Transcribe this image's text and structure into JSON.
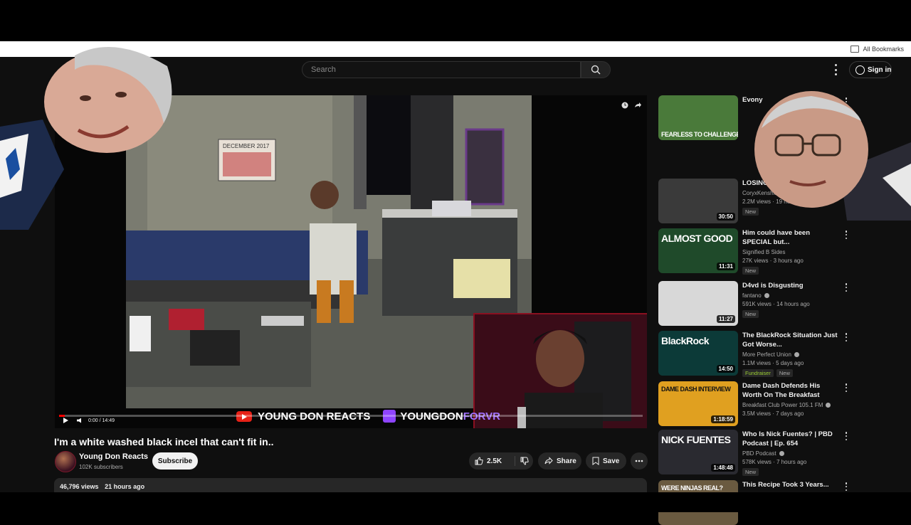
{
  "browser": {
    "bookmarks_label": "All Bookmarks"
  },
  "header": {
    "search_placeholder": "Search",
    "sign_in_label": "Sign in"
  },
  "player": {
    "time_current": "0:00",
    "time_total": "14:49",
    "progress_fraction": 0.01,
    "banner_youtube": "YOUNG DON REACTS",
    "banner_twitch_prefix": "YOUNGDON",
    "banner_twitch_suffix": "FORVR",
    "calendar_text": "DECEMBER 2017"
  },
  "video": {
    "title": "I'm a white washed black incel that can't fit in..",
    "channel": "Young Don Reacts",
    "subscribers": "102K subscribers",
    "subscribe_label": "Subscribe",
    "likes": "2.5K",
    "share_label": "Share",
    "save_label": "Save",
    "views": "46,796 views",
    "posted": "21 hours ago"
  },
  "recommendations": [
    {
      "title": "Evony",
      "channel": "",
      "views": "",
      "age": "",
      "duration": "",
      "thumb_caption": "FEARLESS TO CHALLENGE",
      "thumb_color": "#4a7a3a",
      "verified": false,
      "badges": []
    },
    {
      "title": "LOSING THIS.",
      "channel": "CoryxKenshin",
      "views": "2.2M views",
      "age": "19 hours ago",
      "duration": "30:50",
      "thumb_caption": "",
      "thumb_color": "#3a3a3a",
      "verified": true,
      "badges": [
        "New"
      ]
    },
    {
      "title": "Him could have been SPECIAL but...",
      "channel": "Signified B Sides",
      "views": "27K views",
      "age": "3 hours ago",
      "duration": "11:31",
      "thumb_caption": "ALMOST GOOD",
      "thumb_color": "#1f4a2a",
      "verified": false,
      "badges": [
        "New"
      ]
    },
    {
      "title": "D4vd is Disgusting",
      "channel": "fantano",
      "views": "591K views",
      "age": "14 hours ago",
      "duration": "11:27",
      "thumb_caption": "",
      "thumb_color": "#d8d8d8",
      "verified": true,
      "badges": [
        "New"
      ]
    },
    {
      "title": "The BlackRock Situation Just Got Worse...",
      "channel": "More Perfect Union",
      "views": "1.1M views",
      "age": "5 days ago",
      "duration": "14:50",
      "thumb_caption": "BlackRock",
      "thumb_color": "#0c3a38",
      "verified": true,
      "badges": [
        "Fundraiser",
        "New"
      ]
    },
    {
      "title": "Dame Dash Defends His Worth On The Breakfast Club, ...",
      "channel": "Breakfast Club Power 105.1 FM",
      "views": "3.5M views",
      "age": "7 days ago",
      "duration": "1:18:59",
      "thumb_caption": "DAME DASH INTERVIEW",
      "thumb_color": "#e0a020",
      "verified": true,
      "badges": []
    },
    {
      "title": "Who Is Nick Fuentes? | PBD Podcast | Ep. 654",
      "channel": "PBD Podcast",
      "views": "578K views",
      "age": "7 hours ago",
      "duration": "1:48:48",
      "thumb_caption": "NICK FUENTES",
      "thumb_color": "#2a2a30",
      "verified": true,
      "badges": [
        "New"
      ]
    },
    {
      "title": "This Recipe Took 3 Years...",
      "channel": "",
      "views": "",
      "age": "",
      "duration": "",
      "thumb_caption": "WERE NINJAS REAL?",
      "thumb_color": "#6a5a40",
      "verified": false,
      "badges": []
    }
  ],
  "colors": {
    "page_bg": "#0f0f0f",
    "accent_red": "#ff0000",
    "pill_bg": "#272727",
    "twitch_purple": "#8e44ff"
  }
}
